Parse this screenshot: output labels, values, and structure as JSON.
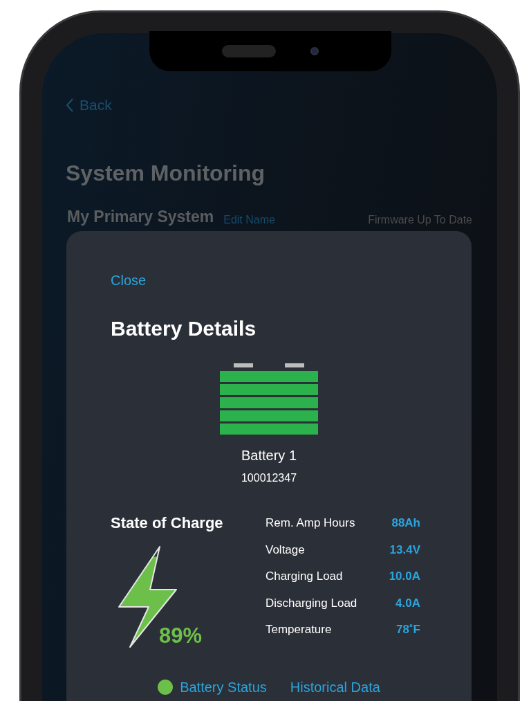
{
  "back": {
    "label": "Back"
  },
  "title": "System Monitoring",
  "system": {
    "name": "My Primary System",
    "edit_link": "Edit Name",
    "firmware": "Firmware Up To Date"
  },
  "modal": {
    "close": "Close",
    "title": "Battery Details",
    "battery": {
      "name": "Battery 1",
      "serial": "100012347"
    },
    "charge": {
      "heading": "State of Charge",
      "level": 0.89,
      "percent": "89%"
    },
    "stats": [
      {
        "label": "Rem. Amp Hours",
        "value": "88Ah"
      },
      {
        "label": "Voltage",
        "value": "13.4V"
      },
      {
        "label": "Charging Load",
        "value": "10.0A"
      },
      {
        "label": "Discharging Load",
        "value": "4.0A"
      },
      {
        "label": "Temperature",
        "value": "78˚F"
      }
    ],
    "links": [
      {
        "label": "Battery Status",
        "color": "#6cc04a"
      },
      {
        "label": "Historical Data"
      }
    ]
  }
}
